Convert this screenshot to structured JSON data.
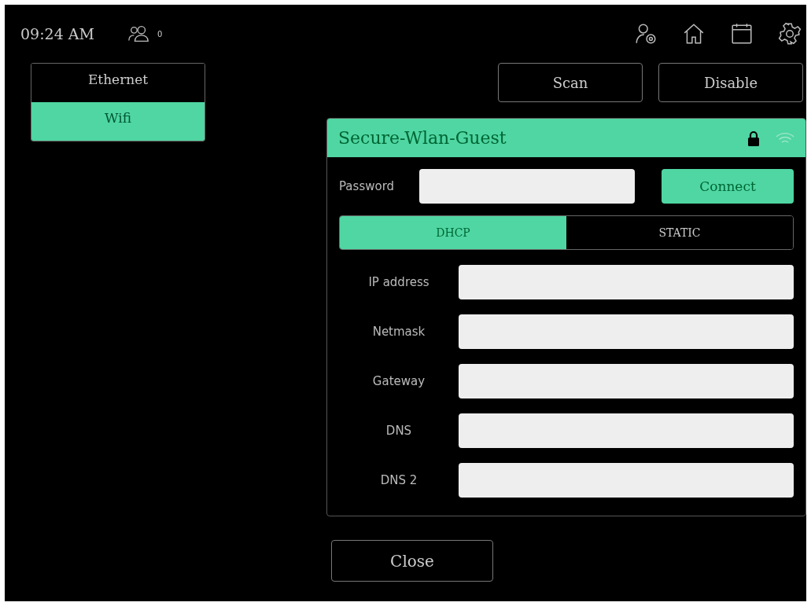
{
  "status_bar": {
    "time": "09:24 AM",
    "user_count": "0"
  },
  "interfaces": [
    {
      "label": "Ethernet",
      "selected": false
    },
    {
      "label": "Wifi",
      "selected": true
    }
  ],
  "actions": [
    "Scan",
    "Disable"
  ],
  "network": {
    "name": "Secure-Wlan-Guest",
    "locked": true,
    "password_label": "Password",
    "connect": "Connect",
    "modes": [
      {
        "label": "DHCP",
        "selected": true
      },
      {
        "label": "STATIC",
        "selected": false
      }
    ],
    "fields": [
      {
        "label": "IP address"
      },
      {
        "label": "Netmask"
      },
      {
        "label": "Gateway"
      },
      {
        "label": "DNS"
      },
      {
        "label": "DNS 2"
      }
    ]
  },
  "close": "Close"
}
